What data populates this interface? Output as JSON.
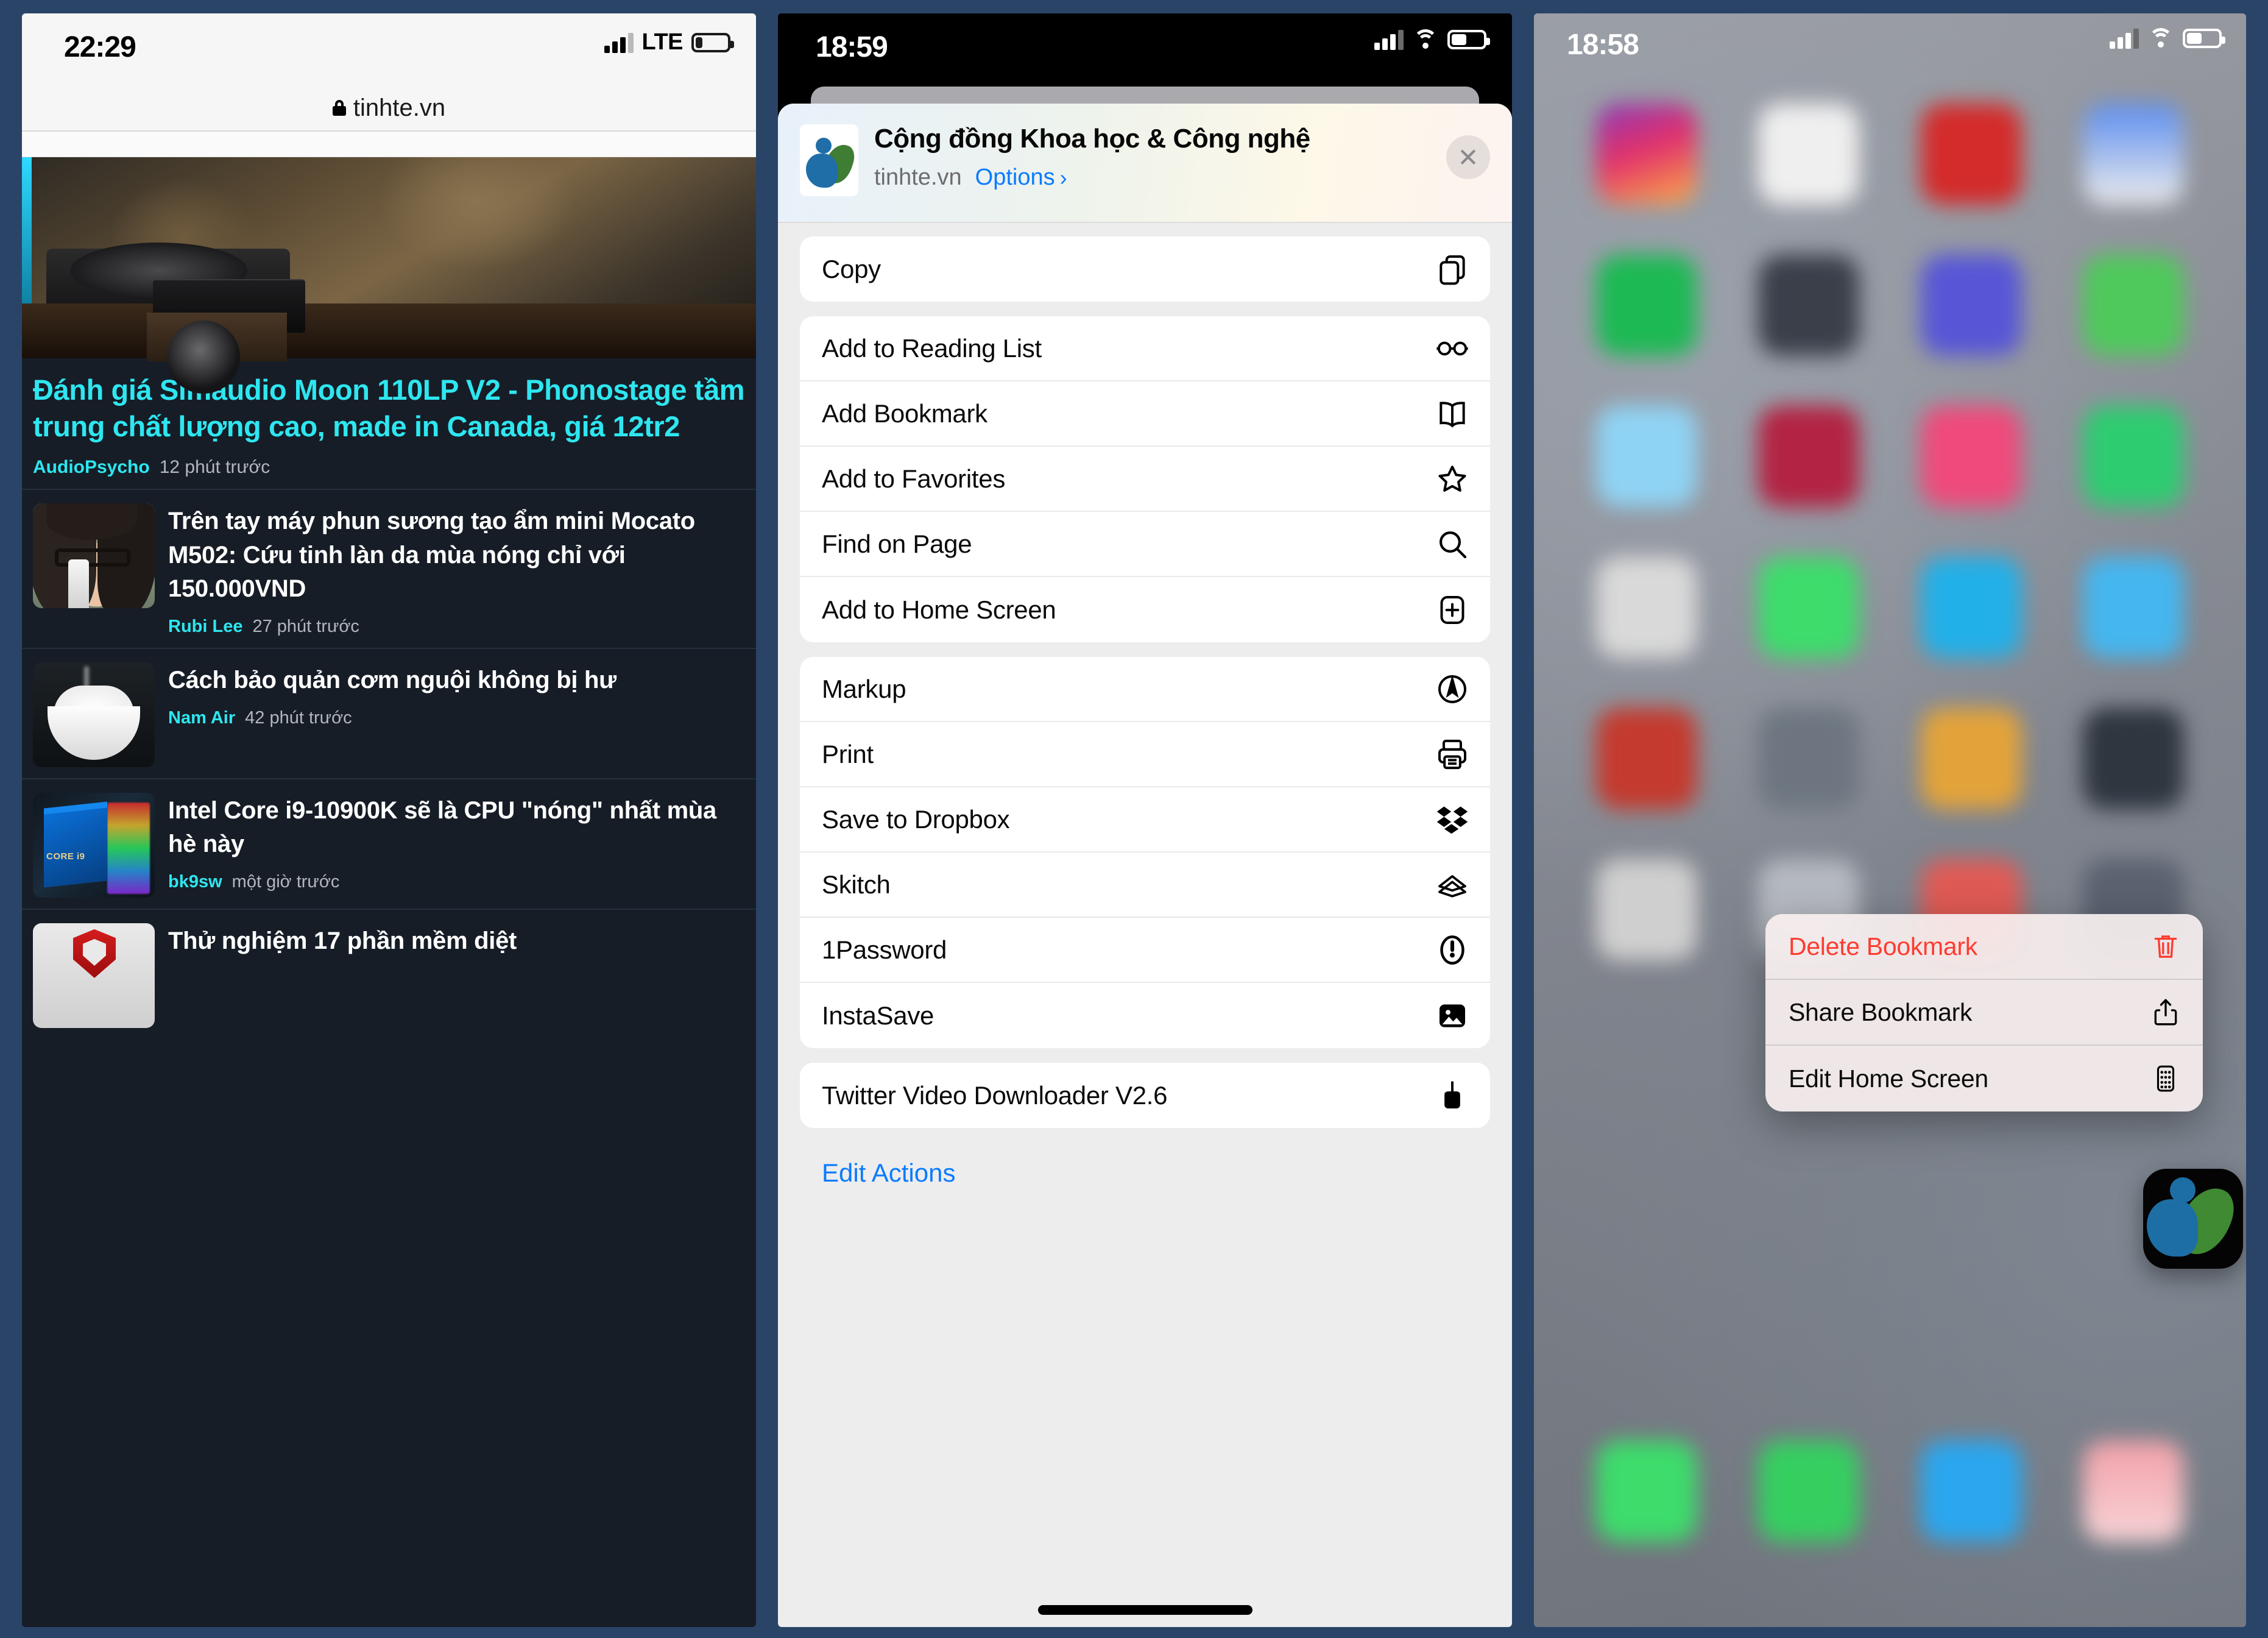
{
  "panel1": {
    "status": {
      "time": "22:29",
      "network": "LTE",
      "signal_icon": "cellular-bars-icon",
      "battery_icon": "battery-low-icon"
    },
    "urlbar": {
      "lock_icon": "lock-icon",
      "url": "tinhte.vn"
    },
    "lead_article": {
      "title": "Đánh giá Simaudio Moon 110LP V2 - Phonostage tầm trung chất lượng cao, made in Canada, giá 12tr2",
      "author": "AudioPsycho",
      "time": "12 phút trước"
    },
    "articles": [
      {
        "title": "Trên tay máy phun sương tạo ẩm mini Mocato M502: Cứu tinh làn da mùa nóng chỉ với 150.000VND",
        "author": "Rubi Lee",
        "time": "27 phút trước",
        "thumb": "girl-mist-sprayer-photo"
      },
      {
        "title": "Cách bảo quản cơm nguội không bị hư",
        "author": "Nam Air",
        "time": "42 phút trước",
        "thumb": "bowl-of-rice-photo"
      },
      {
        "title": "Intel Core i9-10900K sẽ là CPU \"nóng\" nhất mùa hè này",
        "author": "bk9sw",
        "time": "một giờ trước",
        "thumb": "intel-core-i9-box-photo"
      },
      {
        "title": "Thử nghiệm 17 phần mềm diệt",
        "author": "",
        "time": "",
        "thumb": "antivirus-shield-photo"
      }
    ]
  },
  "panel2": {
    "status": {
      "time": "18:59",
      "signal_icon": "cellular-bars-icon",
      "wifi_icon": "wifi-icon",
      "battery_icon": "battery-half-icon"
    },
    "sheet": {
      "site_icon": "tinhte-site-icon",
      "title": "Cộng đồng Khoa học & Công nghệ",
      "domain": "tinhte.vn",
      "options_label": "Options",
      "options_chevron": "chevron-right-icon",
      "close_label": "✕",
      "groups": [
        {
          "items": [
            {
              "label": "Copy",
              "icon": "copy-icon"
            }
          ]
        },
        {
          "items": [
            {
              "label": "Add to Reading List",
              "icon": "glasses-icon"
            },
            {
              "label": "Add Bookmark",
              "icon": "book-icon"
            },
            {
              "label": "Add to Favorites",
              "icon": "star-icon"
            },
            {
              "label": "Find on Page",
              "icon": "search-icon"
            },
            {
              "label": "Add to Home Screen",
              "icon": "add-to-home-screen-icon"
            }
          ]
        },
        {
          "items": [
            {
              "label": "Markup",
              "icon": "markup-pen-icon"
            },
            {
              "label": "Print",
              "icon": "printer-icon"
            },
            {
              "label": "Save to Dropbox",
              "icon": "dropbox-icon"
            },
            {
              "label": "Skitch",
              "icon": "skitch-icon"
            },
            {
              "label": "1Password",
              "icon": "onepassword-icon"
            },
            {
              "label": "InstaSave",
              "icon": "instasave-photo-icon"
            }
          ]
        },
        {
          "items": [
            {
              "label": "Twitter Video Downloader V2.6",
              "icon": "download-icon"
            }
          ]
        }
      ],
      "edit_actions_label": "Edit Actions",
      "home_indicator": "home-indicator"
    }
  },
  "panel3": {
    "status": {
      "time": "18:58",
      "signal_icon": "cellular-bars-icon",
      "wifi_icon": "wifi-icon",
      "battery_icon": "battery-half-icon"
    },
    "context_menu": {
      "items": [
        {
          "label": "Delete Bookmark",
          "icon": "trash-icon",
          "destructive": true
        },
        {
          "label": "Share Bookmark",
          "icon": "share-icon",
          "destructive": false
        },
        {
          "label": "Edit Home Screen",
          "icon": "home-screen-grid-icon",
          "destructive": false
        }
      ]
    },
    "web_clip_icon": "tinhte-web-clip-icon",
    "wallpaper": "blurred-home-screen"
  },
  "colors": {
    "background": "#2a4468",
    "accent_cyan": "#2ee6f0",
    "accent_blue": "#0a7bff",
    "destructive_red": "#ff3b30",
    "dark_page": "#161d26",
    "sheet_bg": "#ededed"
  }
}
